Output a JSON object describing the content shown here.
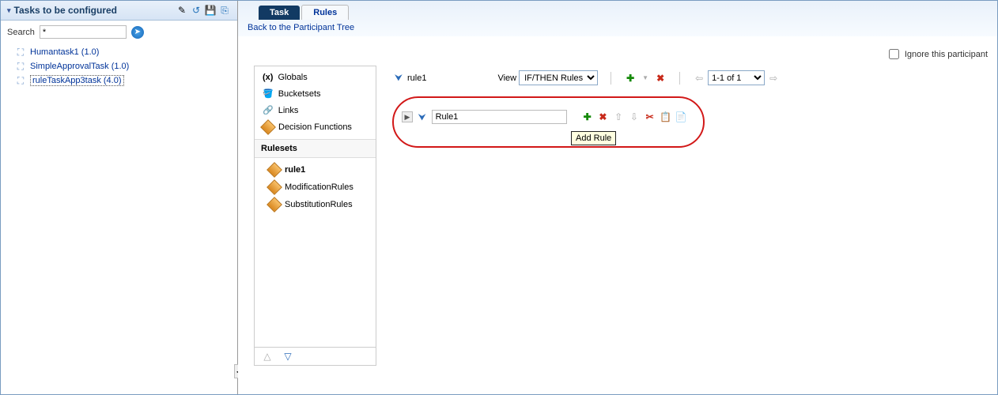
{
  "left": {
    "title": "Tasks to be configured",
    "search_label": "Search",
    "search_value": "*",
    "tasks": [
      {
        "label": "Humantask1 (1.0)"
      },
      {
        "label": "SimpleApprovalTask (1.0)"
      },
      {
        "label": "ruleTaskApp3task (4.0)"
      }
    ]
  },
  "tabs": {
    "task": "Task",
    "rules": "Rules"
  },
  "breadcrumb": "Back to the Participant Tree",
  "ignore_label": "Ignore this participant",
  "side": {
    "items": [
      {
        "label": "Globals"
      },
      {
        "label": "Bucketsets"
      },
      {
        "label": "Links"
      },
      {
        "label": "Decision Functions"
      }
    ],
    "rulesets_heading": "Rulesets",
    "rulesets": [
      {
        "label": "rule1"
      },
      {
        "label": "ModificationRules"
      },
      {
        "label": "SubstitutionRules"
      }
    ]
  },
  "rule": {
    "name": "rule1",
    "view_label": "View",
    "view_value": "IF/THEN Rules",
    "pager": "1-1 of 1",
    "row_value": "Rule1",
    "tooltip": "Add Rule"
  }
}
